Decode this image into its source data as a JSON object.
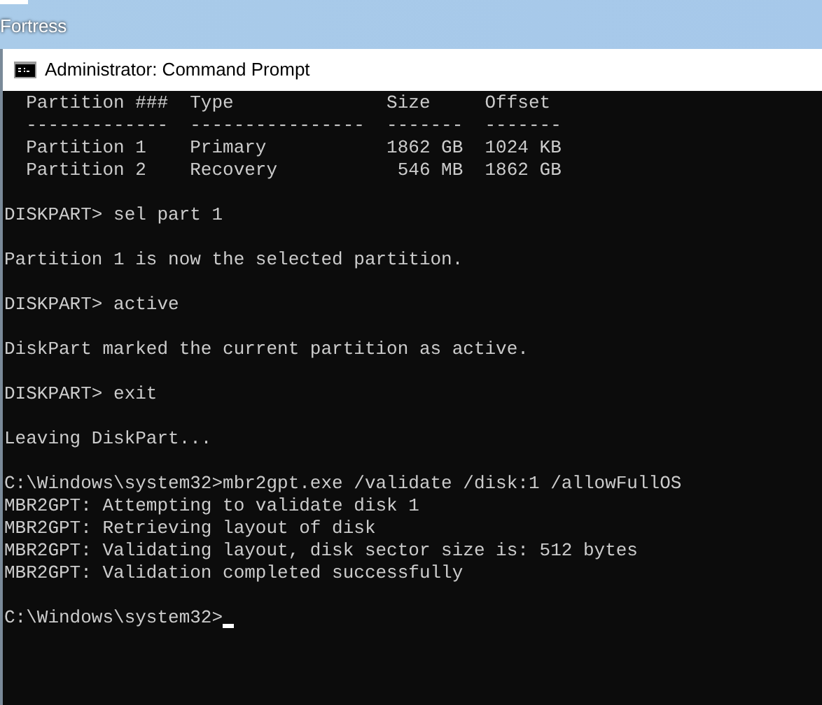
{
  "desktop": {
    "icon_label": "Fortress"
  },
  "window": {
    "title": "Administrator: Command Prompt"
  },
  "console": {
    "blocks": [
      [
        "  Partition ###  Type              Size     Offset",
        "  -------------  ----------------  -------  -------",
        "  Partition 1    Primary           1862 GB  1024 KB",
        "  Partition 2    Recovery           546 MB  1862 GB"
      ],
      [
        "DISKPART> sel part 1"
      ],
      [
        "Partition 1 is now the selected partition."
      ],
      [
        "DISKPART> active"
      ],
      [
        "DiskPart marked the current partition as active."
      ],
      [
        "DISKPART> exit"
      ],
      [
        "Leaving DiskPart..."
      ],
      [
        "C:\\Windows\\system32>mbr2gpt.exe /validate /disk:1 /allowFullOS",
        "MBR2GPT: Attempting to validate disk 1",
        "MBR2GPT: Retrieving layout of disk",
        "MBR2GPT: Validating layout, disk sector size is: 512 bytes",
        "MBR2GPT: Validation completed successfully"
      ]
    ],
    "prompt": "C:\\Windows\\system32>"
  }
}
